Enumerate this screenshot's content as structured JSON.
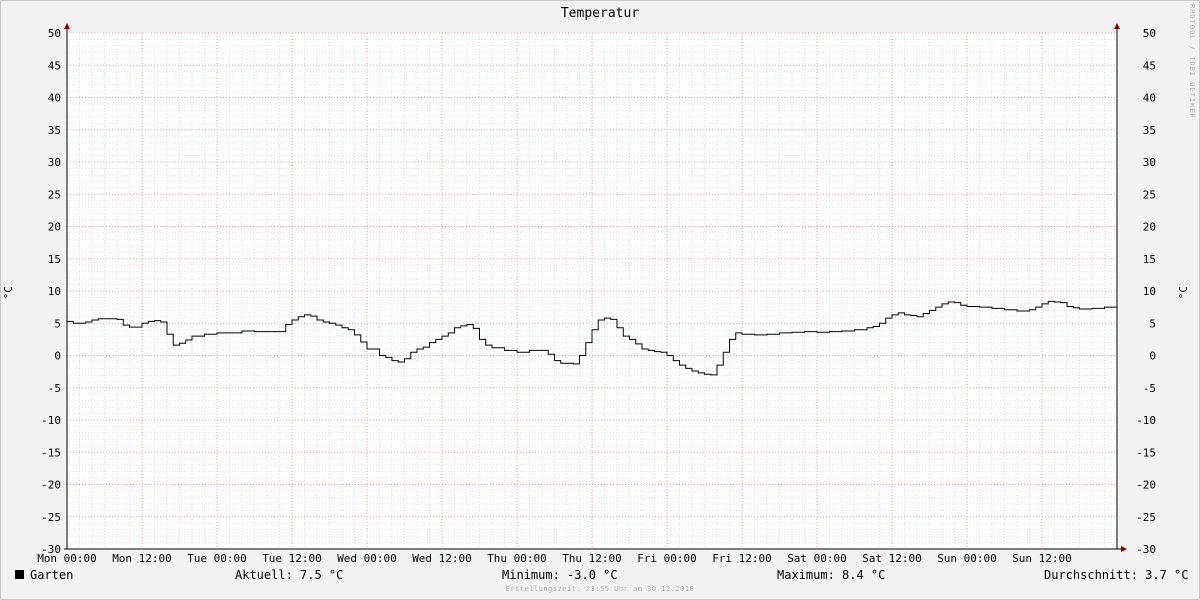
{
  "chart_data": {
    "type": "line",
    "title": "Temperatur",
    "ylabel": "°C",
    "ylim": [
      -30,
      50
    ],
    "yticks": [
      50,
      45,
      40,
      35,
      30,
      25,
      20,
      15,
      10,
      5,
      0,
      -5,
      -10,
      -15,
      -20,
      -25,
      -30
    ],
    "xlim_hours": [
      0,
      168
    ],
    "xticks": [
      {
        "hours": 0,
        "label": "Mon 00:00"
      },
      {
        "hours": 12,
        "label": "Mon 12:00"
      },
      {
        "hours": 24,
        "label": "Tue 00:00"
      },
      {
        "hours": 36,
        "label": "Tue 12:00"
      },
      {
        "hours": 48,
        "label": "Wed 00:00"
      },
      {
        "hours": 60,
        "label": "Wed 12:00"
      },
      {
        "hours": 72,
        "label": "Thu 00:00"
      },
      {
        "hours": 84,
        "label": "Thu 12:00"
      },
      {
        "hours": 96,
        "label": "Fri 00:00"
      },
      {
        "hours": 108,
        "label": "Fri 12:00"
      },
      {
        "hours": 120,
        "label": "Sat 00:00"
      },
      {
        "hours": 132,
        "label": "Sat 12:00"
      },
      {
        "hours": 144,
        "label": "Sun 00:00"
      },
      {
        "hours": 156,
        "label": "Sun 12:00"
      }
    ],
    "grid": true,
    "step": true,
    "series": [
      {
        "name": "Garten",
        "color": "#000000",
        "x": [
          0,
          1,
          3,
          4,
          5,
          8,
          9,
          10,
          12,
          13,
          14,
          15,
          16,
          17,
          18,
          19,
          20,
          22,
          24,
          28,
          30,
          34,
          35,
          36,
          37,
          38,
          39,
          40,
          41,
          42,
          43,
          44,
          45,
          46,
          47,
          48,
          50,
          51,
          52,
          53,
          54,
          55,
          56,
          57,
          58,
          59,
          60,
          61,
          62,
          63,
          64,
          65,
          66,
          67,
          68,
          70,
          72,
          74,
          75,
          76,
          77,
          78,
          79,
          80,
          81,
          82,
          83,
          84,
          85,
          86,
          87,
          88,
          89,
          90,
          91,
          92,
          93,
          94,
          95,
          96,
          97,
          98,
          99,
          100,
          101,
          102,
          103,
          104,
          105,
          106,
          107,
          108,
          110,
          112,
          114,
          116,
          118,
          120,
          122,
          124,
          126,
          128,
          129,
          130,
          131,
          132,
          133,
          134,
          135,
          136,
          137,
          138,
          139,
          140,
          141,
          142,
          143,
          144,
          146,
          148,
          150,
          152,
          154,
          155,
          156,
          157,
          158,
          159,
          160,
          161,
          162,
          163,
          164,
          166,
          167
        ],
        "y": [
          5.3,
          5.0,
          5.2,
          5.5,
          5.7,
          5.6,
          4.7,
          4.4,
          5.0,
          5.3,
          5.4,
          5.2,
          3.3,
          1.6,
          1.9,
          2.4,
          3.0,
          3.3,
          3.5,
          3.8,
          3.7,
          3.7,
          4.8,
          5.5,
          6.0,
          6.3,
          6.1,
          5.5,
          5.2,
          5.0,
          4.7,
          4.3,
          4.0,
          3.2,
          2.1,
          1.0,
          0.0,
          -0.3,
          -0.8,
          -1.0,
          -0.5,
          0.5,
          1.0,
          1.3,
          2.0,
          2.5,
          3.0,
          3.5,
          4.3,
          4.6,
          4.8,
          4.2,
          2.5,
          1.6,
          1.2,
          0.8,
          0.5,
          0.8,
          0.8,
          0.8,
          0.2,
          -0.8,
          -1.2,
          -1.2,
          -1.3,
          0.0,
          2.0,
          4.0,
          5.5,
          5.8,
          5.6,
          4.3,
          3.0,
          2.5,
          1.8,
          1.0,
          0.8,
          0.6,
          0.5,
          0.0,
          -0.8,
          -1.5,
          -2.0,
          -2.4,
          -2.7,
          -2.9,
          -3.0,
          -1.5,
          0.5,
          2.5,
          3.5,
          3.3,
          3.2,
          3.3,
          3.5,
          3.6,
          3.7,
          3.6,
          3.7,
          3.8,
          4.0,
          4.3,
          4.5,
          5.0,
          5.8,
          6.3,
          6.6,
          6.3,
          6.2,
          6.0,
          6.5,
          7.0,
          7.5,
          8.0,
          8.3,
          8.2,
          7.8,
          7.6,
          7.5,
          7.3,
          7.1,
          6.9,
          7.1,
          7.5,
          8.0,
          8.4,
          8.3,
          8.2,
          7.6,
          7.4,
          7.2,
          7.2,
          7.3,
          7.5,
          7.5
        ]
      }
    ]
  },
  "legend": {
    "name": "Garten",
    "color": "#000000",
    "current": "Aktuell: 7.5 °C",
    "minimum": "Minimum: -3.0 °C",
    "maximum": "Maximum: 8.4 °C",
    "average": "Durchschnitt: 3.7 °C"
  },
  "watermark": "RRDTOOL / TOBI OETIKER",
  "footer": "Erstellungszeit: 23:55 Uhr am 30.12.2018"
}
